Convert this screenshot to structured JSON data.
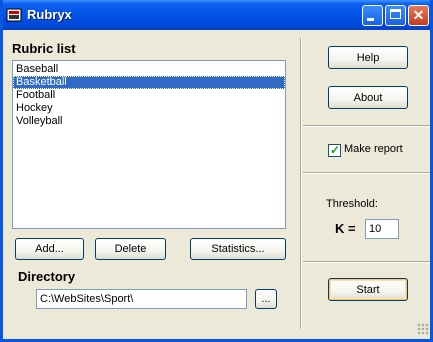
{
  "window": {
    "title": "Rubryx"
  },
  "rubrics": {
    "label": "Rubric list",
    "items": [
      "Baseball",
      "Basketball",
      "Football",
      "Hockey",
      "Volleyball"
    ],
    "selected": "Basketball"
  },
  "list_buttons": {
    "add": "Add...",
    "delete": "Delete",
    "statistics": "Statistics..."
  },
  "directory": {
    "label": "Directory",
    "value": "C:\\WebSites\\Sport\\",
    "browse": "..."
  },
  "side": {
    "help": "Help",
    "about": "About",
    "make_report_label": "Make report",
    "make_report_checked": true,
    "threshold_label": "Threshold:",
    "k_label": "K =",
    "k_value": "10",
    "start": "Start"
  }
}
